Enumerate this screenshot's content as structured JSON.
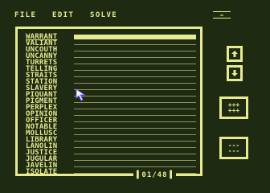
{
  "menu": [
    {
      "label": "FILE"
    },
    {
      "label": "EDIT"
    },
    {
      "label": "SOLVE"
    }
  ],
  "status_icon": "status-indicator-icon",
  "word_list": {
    "selected_index": 0,
    "items": [
      "WARRANT",
      "VALIANT",
      "UNCOUTH",
      "UNCANNY",
      "TURRETS",
      "TELLING",
      "STRAITS",
      "STATION",
      "SLAVERY",
      "PIQUANT",
      "PIGMENT",
      "PERPLEX",
      "OPINION",
      "OFFICER",
      "NOTABLE",
      "MOLLUSC",
      "LIBRARY",
      "LANOLIN",
      "JUSTICE",
      "JUGULAR",
      "JAVELIN",
      "ISOLATE"
    ]
  },
  "pager": {
    "text": "01/48"
  },
  "buttons": {
    "scroll_up": "up-arrow-icon",
    "scroll_down": "down-arrow-icon",
    "add": {
      "glyph_rows": [
        "+++",
        "+++"
      ]
    },
    "remove": {
      "glyph_rows": [
        "---",
        "---"
      ]
    }
  },
  "colors": {
    "background": "#1f2a12",
    "foreground": "#e6ea91"
  }
}
